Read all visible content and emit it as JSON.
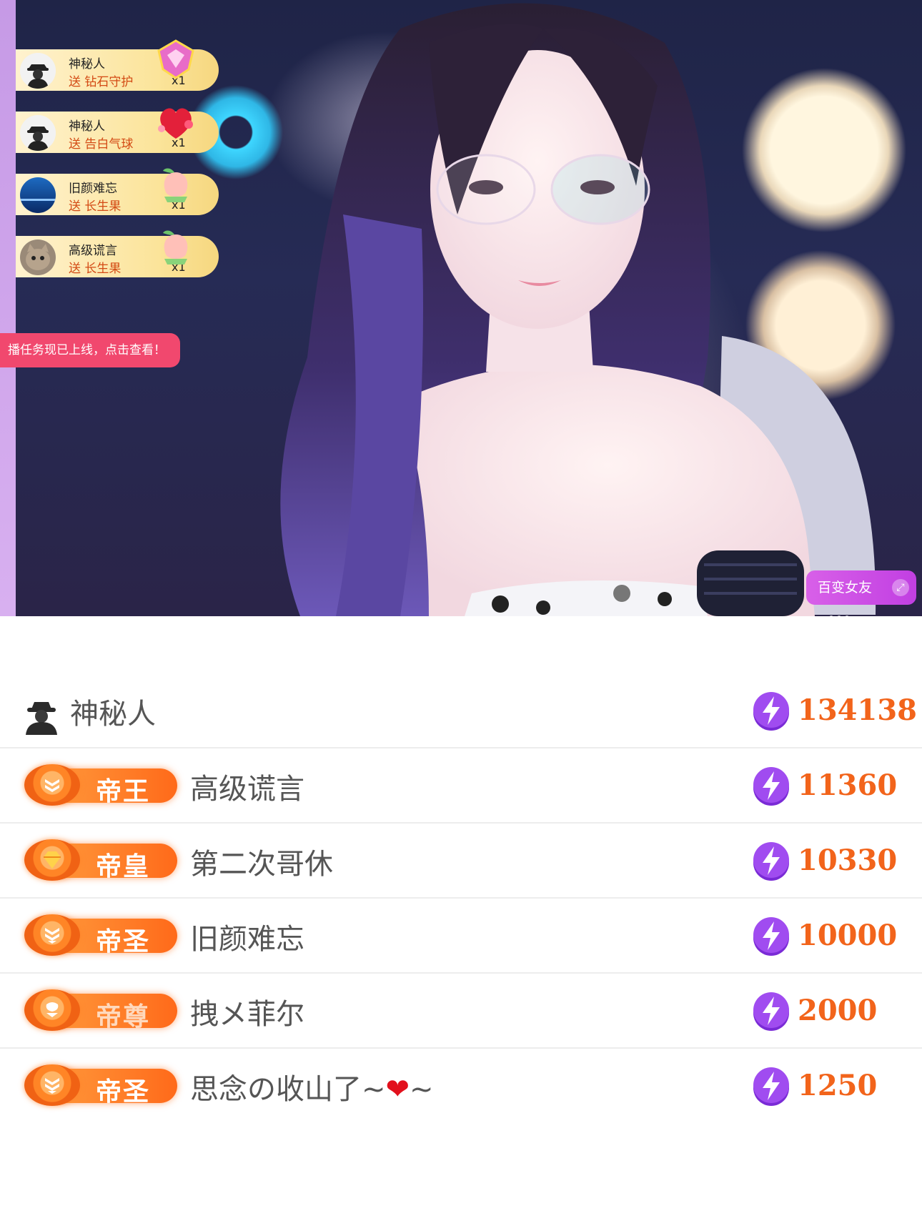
{
  "stream": {
    "gift_feed": [
      {
        "user": "神秘人",
        "send": "送",
        "gift": "钻石守护",
        "count": "x1",
        "avatar": "mystery-avatar",
        "gift_icon": "diamond-shield-icon"
      },
      {
        "user": "神秘人",
        "send": "送",
        "gift": "告白气球",
        "count": "x1",
        "avatar": "mystery-avatar",
        "gift_icon": "heart-balloon-icon"
      },
      {
        "user": "旧颜难忘",
        "send": "送",
        "gift": "长生果",
        "count": "x1",
        "avatar": "earth-avatar",
        "gift_icon": "peach-icon"
      },
      {
        "user": "高级谎言",
        "send": "送",
        "gift": "长生果",
        "count": "x1",
        "avatar": "cat-avatar",
        "gift_icon": "peach-icon"
      }
    ],
    "task_banner": "播任务现已上线，点击查看！",
    "tag_button": "百变女友"
  },
  "ranking": [
    {
      "name": "神秘人",
      "badge": "",
      "score": "134138",
      "mystery": true
    },
    {
      "name": "高级谎言",
      "badge": "帝王",
      "score": "11360"
    },
    {
      "name": "第二次哥休",
      "badge": "帝皇",
      "score": "10330"
    },
    {
      "name": "旧颜难忘",
      "badge": "帝圣",
      "score": "10000"
    },
    {
      "name": "拽メ菲尔",
      "badge": "帝尊",
      "score": "2000"
    },
    {
      "name": "思念の收山了~",
      "name_heart": "❤",
      "name_tail": "~",
      "badge": "帝圣",
      "score": "1250"
    }
  ],
  "colors": {
    "accent_orange": "#f2641b",
    "banner_pink": "#f1486e",
    "tag_purple": "#c13fe2"
  }
}
